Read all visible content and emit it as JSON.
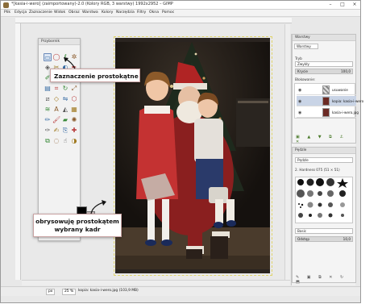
{
  "window": {
    "title": "*[kasia-i-wero] (zaimportowany)-2.0 (Kolory RGB, 3 warstwy) 1992x2952 – GIMP",
    "controls": [
      "–",
      "□",
      "×"
    ]
  },
  "menubar": [
    "Plik",
    "Edycja",
    "Zaznaczenie",
    "Widok",
    "Obraz",
    "Warstwa",
    "Kolory",
    "Narzędzia",
    "Filtry",
    "Okna",
    "Pomoc"
  ],
  "toolbox": {
    "title": "Przybornik",
    "tools": [
      "rect-select",
      "ellipse-select",
      "free-select",
      "fuzzy-select",
      "color-select",
      "scissors",
      "foreground-select",
      "paths",
      "color-picker",
      "zoom",
      "measure",
      "move",
      "align",
      "crop",
      "rotate",
      "scale",
      "shear",
      "perspective",
      "flip",
      "cage",
      "warp",
      "text",
      "bucket-fill",
      "gradient",
      "pencil",
      "paintbrush",
      "eraser",
      "airbrush",
      "ink",
      "mypaint",
      "clone",
      "heal",
      "perspective-clone",
      "blur",
      "smudge",
      "dodge"
    ]
  },
  "callouts": {
    "rect_select": "Zaznaczenie prostokątne",
    "crop_line1": "obrysowuję prostokątem",
    "crop_line2": "wybrany kadr"
  },
  "layers_panel": {
    "title": "Warstwy",
    "tab": "Warstwy",
    "mode_label": "Tryb",
    "mode_value": "Zwykły",
    "opacity_label": "Krycie",
    "opacity_value": "100,0",
    "lock_label": "Blokowanie:",
    "layers": [
      {
        "name": "usuwanie",
        "visible": true,
        "thumb": "checker"
      },
      {
        "name": "kopia: kasia-i-wero",
        "visible": true,
        "thumb": "photo"
      },
      {
        "name": "kasia-i-wero.jpg",
        "visible": true,
        "thumb": "photo"
      }
    ]
  },
  "brushes_panel": {
    "title": "Pędzle",
    "filter_placeholder": "Pędzle",
    "brush_name": "2. Hardness 075 (51 × 51)",
    "tag_label": "Basic",
    "spacing_label": "Odstęp",
    "spacing_value": "10,0"
  },
  "statusbar": {
    "unit": "px",
    "zoom": "25 %",
    "info": "kopia: kasia-i-wero.jpg (103,9 MB)"
  },
  "colors": {
    "accent_callout_border": "#c9a3a3",
    "selection_dash": "#e0d46a",
    "fg_color": "#000000",
    "bg_color": "#c2b5b5"
  }
}
